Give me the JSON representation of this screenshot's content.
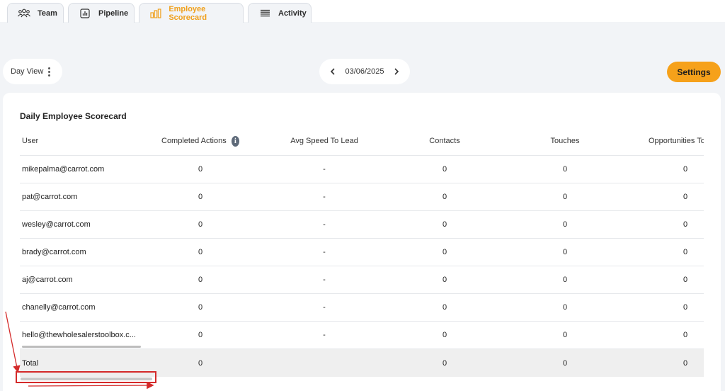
{
  "tabs": [
    {
      "label": "Team",
      "icon": "team-icon"
    },
    {
      "label": "Pipeline",
      "icon": "chart-icon"
    },
    {
      "label": "Employee Scorecard",
      "icon": "bar-chart-icon",
      "active": true
    },
    {
      "label": "Activity",
      "icon": "list-icon"
    }
  ],
  "toolbar": {
    "view_label": "Day View",
    "date": "03/06/2025",
    "settings_label": "Settings"
  },
  "scorecard": {
    "title": "Daily Employee Scorecard",
    "columns": [
      "User",
      "Completed Actions",
      "Avg Speed To Lead",
      "Contacts",
      "Touches",
      "Opportunities Tou"
    ],
    "rows": [
      {
        "user": "mikepalma@carrot.com",
        "completed": "0",
        "speed": "-",
        "contacts": "0",
        "touches": "0",
        "opps": "0"
      },
      {
        "user": "pat@carrot.com",
        "completed": "0",
        "speed": "-",
        "contacts": "0",
        "touches": "0",
        "opps": "0"
      },
      {
        "user": "wesley@carrot.com",
        "completed": "0",
        "speed": "-",
        "contacts": "0",
        "touches": "0",
        "opps": "0"
      },
      {
        "user": "brady@carrot.com",
        "completed": "0",
        "speed": "-",
        "contacts": "0",
        "touches": "0",
        "opps": "0"
      },
      {
        "user": "aj@carrot.com",
        "completed": "0",
        "speed": "-",
        "contacts": "0",
        "touches": "0",
        "opps": "0"
      },
      {
        "user": "chanelly@carrot.com",
        "completed": "0",
        "speed": "-",
        "contacts": "0",
        "touches": "0",
        "opps": "0"
      },
      {
        "user": "hello@thewholesalerstoolbox.c...",
        "completed": "0",
        "speed": "-",
        "contacts": "0",
        "touches": "0",
        "opps": "0"
      }
    ],
    "total": {
      "label": "Total",
      "completed": "0",
      "contacts": "0",
      "touches": "0",
      "opps": "0"
    }
  },
  "colors": {
    "accent": "#f6a11a",
    "annotation": "#d42a2a"
  }
}
